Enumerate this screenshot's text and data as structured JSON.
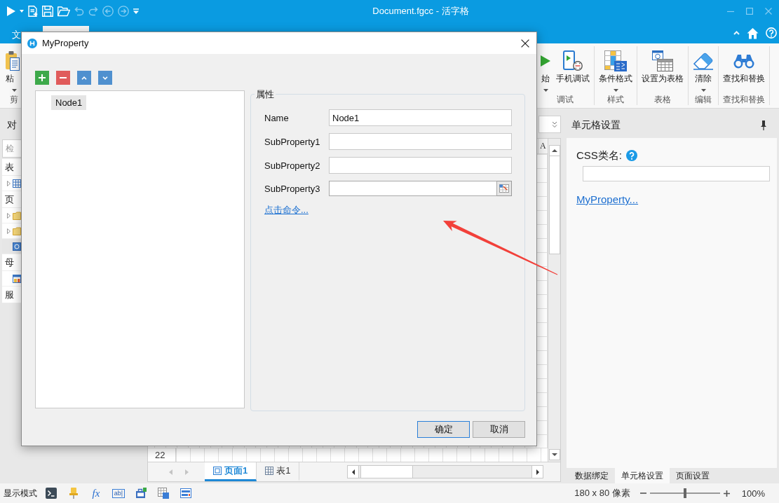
{
  "window": {
    "title": "Document.fgcc - 活字格"
  },
  "quick_access": [
    {
      "kind": "run",
      "disabled": false
    },
    {
      "kind": "run_menu",
      "disabled": false
    },
    {
      "kind": "new",
      "disabled": false
    },
    {
      "kind": "save",
      "disabled": false
    },
    {
      "kind": "open",
      "disabled": false
    },
    {
      "kind": "undo",
      "disabled": true
    },
    {
      "kind": "redo",
      "disabled": true
    },
    {
      "kind": "back",
      "disabled": true
    },
    {
      "kind": "forward",
      "disabled": true
    },
    {
      "kind": "customize",
      "disabled": false
    }
  ],
  "ribbon": {
    "tabs": [
      {
        "label": "文",
        "selected": false
      },
      {
        "selected": true
      }
    ],
    "groups": [
      {
        "label": "剪",
        "buttons": [
          {
            "label": "粘",
            "dropdown": true
          }
        ]
      },
      {
        "label": "调试",
        "buttons": [
          {
            "label": "始",
            "dropdown": true
          },
          {
            "label": "手机调试",
            "dropdown": false
          }
        ]
      },
      {
        "label": "样式",
        "buttons": [
          {
            "label": "条件格式",
            "dropdown": true
          }
        ]
      },
      {
        "label": "表格",
        "buttons": [
          {
            "label": "设置为表格",
            "dropdown": false
          }
        ]
      },
      {
        "label": "编辑",
        "buttons": [
          {
            "label": "清除",
            "dropdown": true
          }
        ]
      },
      {
        "label": "查找和替换",
        "buttons": [
          {
            "label": "查找和替换",
            "dropdown": false
          }
        ]
      }
    ]
  },
  "object_panel": {
    "title": "对",
    "search": {
      "placeholder": "检"
    },
    "sections": [
      {
        "label": "表",
        "items": [
          {
            "kind": "table",
            "expandable": true,
            "selected": false
          }
        ]
      },
      {
        "label": "页",
        "items": [
          {
            "kind": "folder",
            "expandable": true,
            "selected": false
          },
          {
            "kind": "folder",
            "expandable": true,
            "selected": false
          },
          {
            "kind": "page",
            "expandable": false,
            "selected": true
          }
        ]
      },
      {
        "label": "母",
        "items": [
          {
            "kind": "master",
            "expandable": false,
            "selected": false
          }
        ]
      },
      {
        "label": "服"
      }
    ]
  },
  "sheet": {
    "column_headers": [
      "A"
    ],
    "row_headers": [
      "22"
    ],
    "tabs": [
      {
        "label": "页面1",
        "kind": "page",
        "selected": true
      },
      {
        "label": "表1",
        "kind": "table",
        "selected": false
      }
    ]
  },
  "cell_settings": {
    "title": "单元格设置",
    "css_label": "CSS类名:",
    "link": "MyProperty...",
    "tabs": [
      {
        "label": "数据绑定",
        "selected": false
      },
      {
        "label": "单元格设置",
        "selected": true
      },
      {
        "label": "页面设置",
        "selected": false
      }
    ]
  },
  "status_bar": {
    "mode_label": "显示模式",
    "tools": [
      {
        "kind": "terminal"
      },
      {
        "kind": "pushpin"
      },
      {
        "kind": "formula",
        "label": "fx"
      },
      {
        "kind": "textbox",
        "label": "ab|"
      },
      {
        "kind": "toolbox"
      },
      {
        "kind": "table"
      },
      {
        "kind": "panel"
      }
    ],
    "size": "180 x 80 像素",
    "zoom": {
      "level": 0.5,
      "reading": "100%"
    }
  },
  "dialog": {
    "title": "MyProperty",
    "toolbar": [
      {
        "kind": "add"
      },
      {
        "kind": "remove"
      },
      {
        "kind": "move_up"
      },
      {
        "kind": "move_down"
      }
    ],
    "tree": [
      {
        "label": "Node1",
        "selected": true
      }
    ],
    "group_title": "属性",
    "fields": [
      {
        "label": "Name",
        "kind": "text",
        "value": "Node1"
      },
      {
        "label": "SubProperty1",
        "kind": "text"
      },
      {
        "label": "SubProperty2",
        "kind": "text"
      },
      {
        "label": "SubProperty3",
        "kind": "picker"
      }
    ],
    "link": "点击命令...",
    "buttons": [
      {
        "label": "确定",
        "default": true
      },
      {
        "label": "取消",
        "default": false
      }
    ]
  },
  "annotations": [
    {
      "kind": "arrow"
    }
  ]
}
